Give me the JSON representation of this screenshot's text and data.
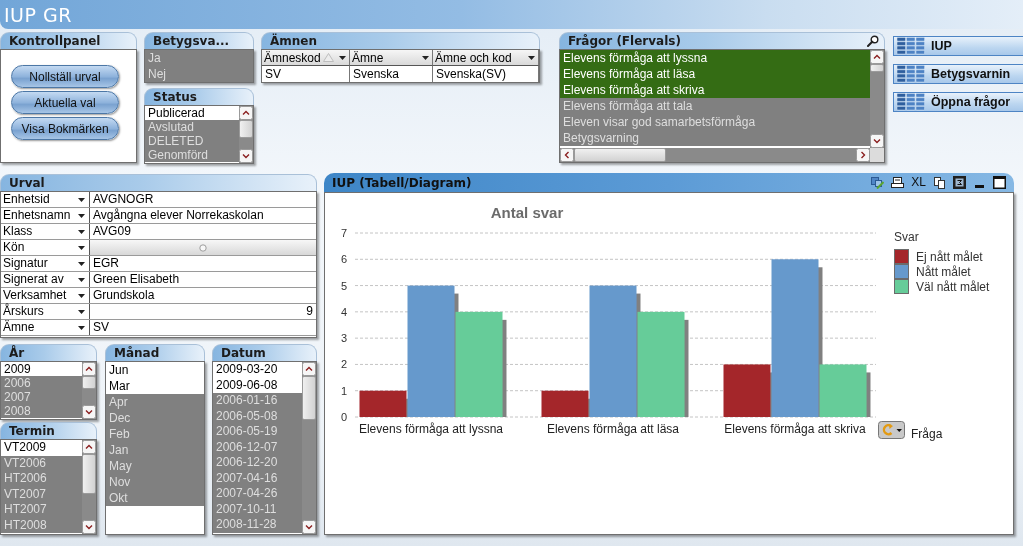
{
  "app_title": "IUP GR",
  "control_panel": {
    "caption": "Kontrollpanel",
    "buttons": [
      "Nollställ urval",
      "Aktuella val",
      "Visa Bokmärken"
    ]
  },
  "betyg_list": {
    "caption": "Betygsva...",
    "scrollbar": false,
    "items": [
      {
        "label": "Ja",
        "selected": false,
        "excluded": true
      },
      {
        "label": "Nej",
        "selected": false,
        "excluded": true
      }
    ]
  },
  "status_list": {
    "caption": "Status",
    "scrollbar": true,
    "items": [
      {
        "label": "Publicerad",
        "selected": false,
        "excluded": false
      },
      {
        "label": "Avslutad",
        "selected": false,
        "excluded": true
      },
      {
        "label": "DELETED",
        "selected": false,
        "excluded": true
      },
      {
        "label": "Genomförd",
        "selected": false,
        "excluded": true
      }
    ]
  },
  "amnen_table": {
    "caption": "Ämnen",
    "columns": [
      {
        "label": "Ämneskod",
        "sorted": true
      },
      {
        "label": "Ämne",
        "sorted": false
      },
      {
        "label": "Ämne och kod",
        "sorted": false
      }
    ],
    "rows": [
      [
        "SV",
        "Svenska",
        "Svenska(SV)"
      ]
    ]
  },
  "fragor_list": {
    "caption": "Frågor (Flervals)",
    "search": true,
    "scrollbar": true,
    "h_scrollbar": true,
    "items": [
      {
        "label": "Elevens förmåga att lyssna",
        "selected": true,
        "excluded": false
      },
      {
        "label": "Elevens förmåga att läsa",
        "selected": true,
        "excluded": false
      },
      {
        "label": "Elevens förmåga att skriva",
        "selected": true,
        "excluded": false
      },
      {
        "label": "Elevens förmåga att tala",
        "selected": false,
        "excluded": true
      },
      {
        "label": "Eleven visar god samarbetsförmåga",
        "selected": false,
        "excluded": true
      },
      {
        "label": "Betygsvarning",
        "selected": false,
        "excluded": true
      }
    ]
  },
  "sheet_buttons": [
    "IUP",
    "Betygsvarnin",
    "Öppna frågor"
  ],
  "urval": {
    "caption": "Urval",
    "rows": [
      {
        "label": "Enhetsid",
        "kind": "text",
        "value": "AVGNOGR"
      },
      {
        "label": "Enhetsnamn",
        "kind": "text",
        "value": "Avgångna elever Norrekaskolan"
      },
      {
        "label": "Klass",
        "kind": "text",
        "value": "AVG09"
      },
      {
        "label": "Kön",
        "kind": "empty"
      },
      {
        "label": "Signatur",
        "kind": "text",
        "value": "EGR"
      },
      {
        "label": "Signerat av",
        "kind": "text",
        "value": "Green Elisabeth"
      },
      {
        "label": "Verksamhet",
        "kind": "text",
        "value": "Grundskola"
      },
      {
        "label": "Årskurs",
        "kind": "number",
        "value": "9"
      },
      {
        "label": "Ämne",
        "kind": "text",
        "value": "SV"
      }
    ]
  },
  "chart": {
    "caption": "IUP (Tabell/Diagram)",
    "toolbar_text": "XL",
    "cycle_label": "Fråga",
    "chart_data": {
      "type": "bar",
      "title": "Antal svar",
      "categories": [
        "Elevens förmåga att lyssna",
        "Elevens förmåga att läsa",
        "Elevens förmåga att skriva"
      ],
      "series": [
        {
          "name": "Ej nått målet",
          "color": "#a4262a",
          "values": [
            1,
            1,
            2
          ]
        },
        {
          "name": "Nått målet",
          "color": "#6699cc",
          "values": [
            5,
            5,
            6
          ]
        },
        {
          "name": "Väl nått målet",
          "color": "#66cc99",
          "values": [
            4,
            4,
            2
          ]
        }
      ],
      "ylim": [
        0,
        7
      ],
      "yticks": [
        0,
        1,
        2,
        3,
        4,
        5,
        6,
        7
      ],
      "grid": true,
      "legend": {
        "title": "Svar"
      }
    }
  },
  "ar_list": {
    "caption": "År",
    "scrollbar": true,
    "items": [
      {
        "label": "2009",
        "selected": false,
        "excluded": false
      },
      {
        "label": "2006",
        "selected": false,
        "excluded": true
      },
      {
        "label": "2007",
        "selected": false,
        "excluded": true
      },
      {
        "label": "2008",
        "selected": false,
        "excluded": true
      }
    ]
  },
  "termin_list": {
    "caption": "Termin",
    "scrollbar": true,
    "items": [
      {
        "label": "VT2009",
        "selected": false,
        "excluded": false
      },
      {
        "label": "VT2006",
        "selected": false,
        "excluded": true
      },
      {
        "label": "HT2006",
        "selected": false,
        "excluded": true
      },
      {
        "label": "VT2007",
        "selected": false,
        "excluded": true
      },
      {
        "label": "HT2007",
        "selected": false,
        "excluded": true
      },
      {
        "label": "HT2008",
        "selected": false,
        "excluded": true
      }
    ]
  },
  "manad_list": {
    "caption": "Månad",
    "scrollbar": false,
    "items": [
      {
        "label": "Jun",
        "selected": false,
        "excluded": false
      },
      {
        "label": "Mar",
        "selected": false,
        "excluded": false
      },
      {
        "label": "Apr",
        "selected": false,
        "excluded": true
      },
      {
        "label": "Dec",
        "selected": false,
        "excluded": true
      },
      {
        "label": "Feb",
        "selected": false,
        "excluded": true
      },
      {
        "label": "Jan",
        "selected": false,
        "excluded": true
      },
      {
        "label": "May",
        "selected": false,
        "excluded": true
      },
      {
        "label": "Nov",
        "selected": false,
        "excluded": true
      },
      {
        "label": "Okt",
        "selected": false,
        "excluded": true
      }
    ]
  },
  "datum_list": {
    "caption": "Datum",
    "scrollbar": true,
    "items": [
      {
        "label": "2009-03-20",
        "selected": false,
        "excluded": false
      },
      {
        "label": "2009-06-08",
        "selected": false,
        "excluded": false
      },
      {
        "label": "2006-01-16",
        "selected": false,
        "excluded": true
      },
      {
        "label": "2006-05-08",
        "selected": false,
        "excluded": true
      },
      {
        "label": "2006-05-19",
        "selected": false,
        "excluded": true
      },
      {
        "label": "2006-12-07",
        "selected": false,
        "excluded": true
      },
      {
        "label": "2006-12-20",
        "selected": false,
        "excluded": true
      },
      {
        "label": "2007-04-16",
        "selected": false,
        "excluded": true
      },
      {
        "label": "2007-04-26",
        "selected": false,
        "excluded": true
      },
      {
        "label": "2007-10-11",
        "selected": false,
        "excluded": true
      },
      {
        "label": "2008-11-28",
        "selected": false,
        "excluded": true
      }
    ]
  }
}
